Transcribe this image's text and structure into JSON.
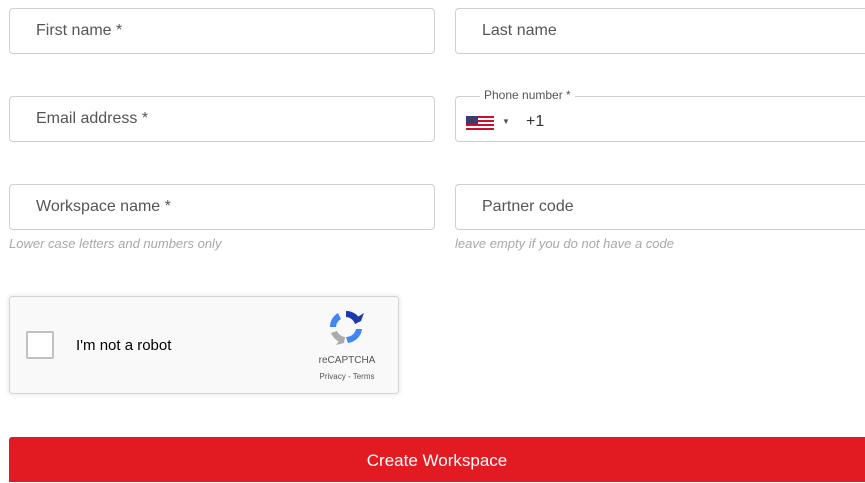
{
  "form": {
    "first_name": {
      "placeholder": "First name *"
    },
    "last_name": {
      "placeholder": "Last name"
    },
    "email": {
      "placeholder": "Email address *"
    },
    "phone": {
      "label": "Phone number *",
      "country_flag": "us-flag-icon",
      "dial_code": "+1"
    },
    "workspace_name": {
      "placeholder": "Workspace name *",
      "helper": "Lower case letters and numbers only"
    },
    "partner_code": {
      "placeholder": "Partner code",
      "helper": "leave empty if you do not have a code"
    },
    "recaptcha": {
      "label": "I'm not a robot",
      "brand": "reCAPTCHA",
      "privacy": "Privacy",
      "separator": " - ",
      "terms": "Terms",
      "checked": false
    },
    "submit_label": "Create Workspace"
  },
  "colors": {
    "accent": "#e21b23",
    "border": "#cfcfcf",
    "helper_text": "#a8a8a8",
    "placeholder_text": "#555555"
  }
}
